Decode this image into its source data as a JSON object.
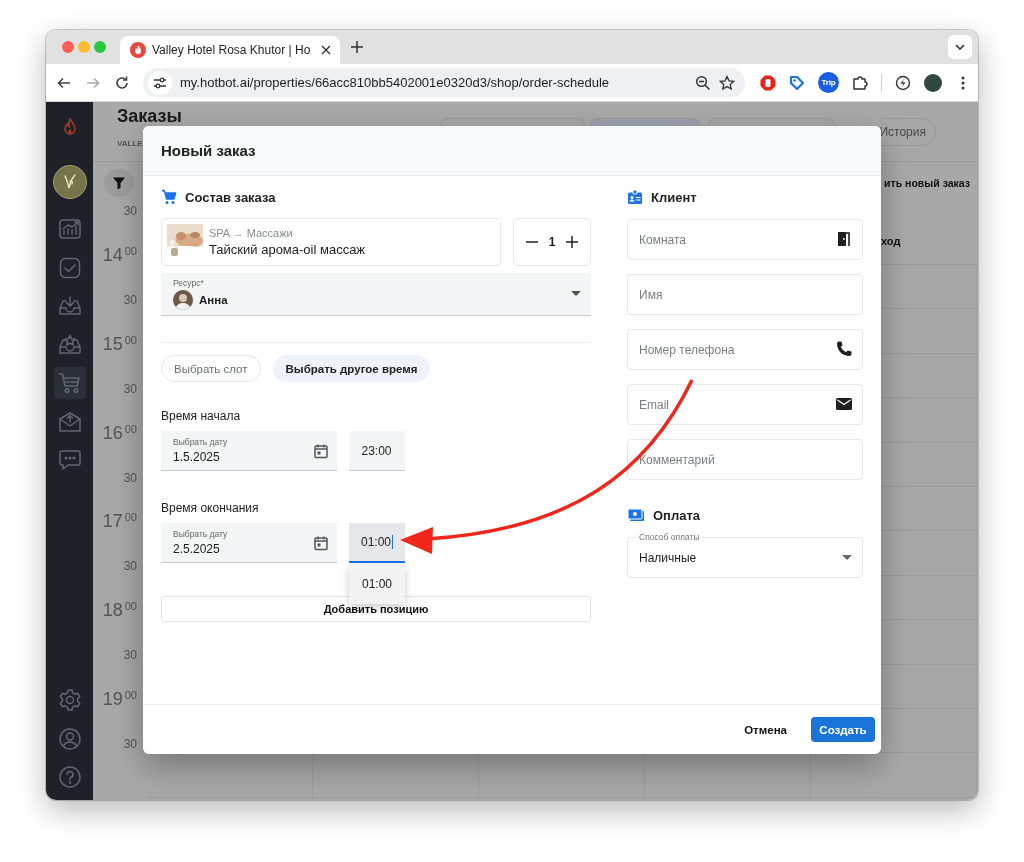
{
  "browser": {
    "tab_title": "Valley Hotel Rosa Khutor | Ho",
    "url": "my.hotbot.ai/properties/66acc810bb5402001e0320d3/shop/order-schedule",
    "extension_label": "Trip"
  },
  "sidebar": {
    "items": [
      {
        "selected": false
      },
      {
        "selected": false
      },
      {
        "selected": false
      },
      {
        "selected": false
      },
      {
        "selected": true
      },
      {
        "selected": false
      },
      {
        "selected": false
      }
    ]
  },
  "page": {
    "title": "Заказы",
    "subtitle": "VALLE",
    "history_button": "История",
    "new_order_text": "ить новый заказ",
    "column_header": "ход",
    "time_labels": [
      {
        "kind": "half",
        "text": "30"
      },
      {
        "kind": "hour",
        "text": "14$^{00}$"
      },
      {
        "kind": "half",
        "text": "30"
      },
      {
        "kind": "hour",
        "text": "15$^{00}$"
      },
      {
        "kind": "half",
        "text": "30"
      },
      {
        "kind": "hour",
        "text": "16$^{00}$"
      },
      {
        "kind": "half",
        "text": "30"
      },
      {
        "kind": "hour",
        "text": "17$^{00}$"
      },
      {
        "kind": "half",
        "text": "30"
      },
      {
        "kind": "hour",
        "text": "18$^{00}$"
      },
      {
        "kind": "half",
        "text": "30"
      },
      {
        "kind": "hour",
        "text": "19$^{00}$"
      },
      {
        "kind": "half",
        "text": "30"
      }
    ]
  },
  "modal": {
    "title": "Новый заказ",
    "order": {
      "heading": "Состав заказа",
      "item": {
        "path": "SPA → Массажи",
        "name": "Тайский арома-oil массаж",
        "quantity": "1"
      },
      "resource": {
        "label": "Ресурс*",
        "value": "Анна"
      },
      "slot_buttons": [
        {
          "label": "Выбрать слот",
          "selected": false
        },
        {
          "label": "Выбрать другое время",
          "selected": true
        }
      ],
      "start": {
        "label": "Время начала",
        "date_label": "Выбрать дату",
        "date": "1.5.2025",
        "time": {
          "value": "23:00",
          "focused": false
        }
      },
      "end": {
        "label": "Время окончания",
        "date_label": "Выбрать дату",
        "date": "2.5.2025",
        "time": {
          "value": "01:00",
          "focused": true
        }
      },
      "time_option": "01:00",
      "add_button": "Добавить позицию"
    },
    "client": {
      "heading": "Клиент",
      "fields": [
        {
          "placeholder": "Комната",
          "kind": "door"
        },
        {
          "placeholder": "Имя",
          "kind": "plain"
        },
        {
          "placeholder": "Номер телефона",
          "kind": "phone"
        },
        {
          "placeholder": "Email",
          "kind": "email"
        },
        {
          "placeholder": "Комментарий",
          "kind": "plain"
        }
      ]
    },
    "payment": {
      "heading": "Оплата",
      "label": "Способ оплаты",
      "value": "Наличные"
    },
    "actions": {
      "cancel": "Отмена",
      "submit": "Создать"
    }
  }
}
